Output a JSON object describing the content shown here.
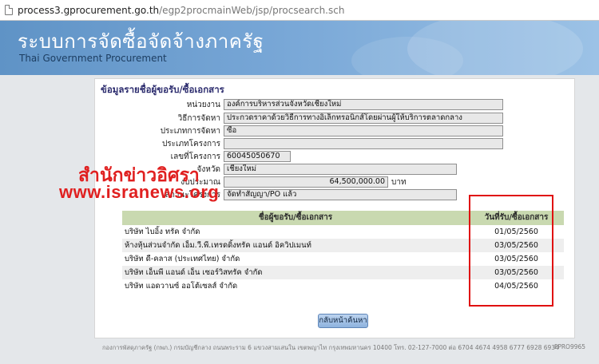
{
  "browser": {
    "url_host": "process3.gprocurement.go.th",
    "url_path": "/egp2procmainWeb/jsp/procsearch.sch"
  },
  "header": {
    "title": "ระบบการจัดซื้อจัดจ้างภาครัฐ",
    "subtitle": "Thai Government Procurement"
  },
  "section": {
    "title": "ข้อมูลรายชื่อผู้ขอรับ/ซื้อเอกสาร"
  },
  "form": [
    {
      "label": "หน่วยงาน",
      "value": "องค์การบริหารส่วนจังหวัดเชียงใหม่"
    },
    {
      "label": "วิธีการจัดหา",
      "value": "ประกวดราคาด้วยวิธีการทางอิเล็กทรอนิกส์โดยผ่านผู้ให้บริการตลาดกลาง"
    },
    {
      "label": "ประเภทการจัดหา",
      "value": "ซื้อ"
    },
    {
      "label": "ประเภทโครงการ",
      "value": ""
    },
    {
      "label": "เลขที่โครงการ",
      "value": "60045050670"
    },
    {
      "label": "จังหวัด",
      "value": "เชียงใหม่"
    },
    {
      "label": "งบประมาณ",
      "value": "64,500,000.00",
      "unit": "บาท"
    },
    {
      "label": "สถานะโครงการ",
      "value": "จัดทำสัญญา/PO แล้ว"
    }
  ],
  "watermark": {
    "line1": "สำนักข่าวอิศรา",
    "line2": "www.isranews.org"
  },
  "table": {
    "headers": [
      "ชื่อผู้ขอรับ/ซื้อเอกสาร",
      "วันที่รับ/ซื้อเอกสาร"
    ],
    "rows": [
      {
        "name": "บริษัท ไบอิ้ง ทรัค จำกัด",
        "date": "01/05/2560"
      },
      {
        "name": "ห้างหุ้นส่วนจำกัด เอ็ม.วี.พี.เทรดดิ้งทรัค แอนด์ อิควิปเมนท์",
        "date": "03/05/2560"
      },
      {
        "name": "บริษัท ดี-คลาส (ประเทศไทย) จำกัด",
        "date": "03/05/2560"
      },
      {
        "name": "บริษัท เอ็นพี แอนด์ เอ็น เซอร์วิสทรัค จำกัด",
        "date": "03/05/2560"
      },
      {
        "name": "บริษัท แอดวานซ์ ออโต้เซลส์ จำกัด",
        "date": "04/05/2560"
      }
    ]
  },
  "buttons": {
    "back": "กลับหน้าค้นหา"
  },
  "footer": {
    "text": "กองการพัสดุภาครัฐ (กพภ.) กรมบัญชีกลาง ถนนพระราม 6 แขวงสามเสนใน เขตพญาไท กรุงเทพมหานคร 10400 โทร. 02-127-7000 ต่อ 6704 4674 4958 6777 6928 6934",
    "code": "FPRO9965"
  },
  "colors": {
    "highlight_box": "#e01010",
    "watermark": "#e02020",
    "table_header": "#c9d9b0"
  }
}
